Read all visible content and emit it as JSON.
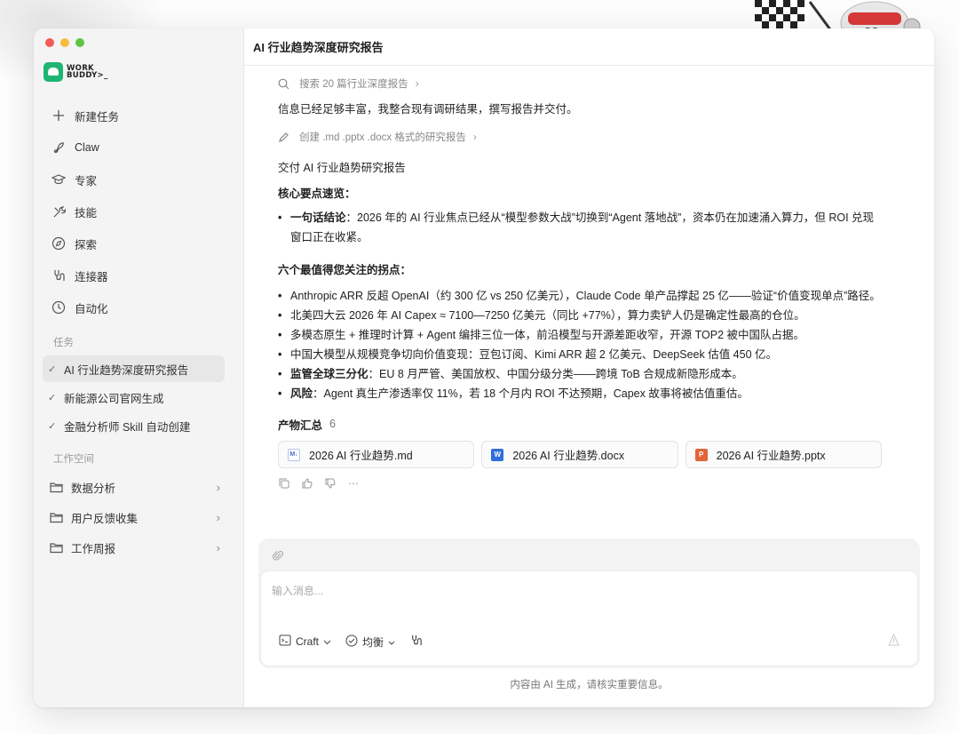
{
  "app": {
    "logo_text_line1": "WORK",
    "logo_text_line2": "BUDDY>_"
  },
  "sidebar": {
    "nav": [
      {
        "label": "新建任务",
        "icon": "plus-icon"
      },
      {
        "label": "Claw",
        "icon": "claw-icon"
      },
      {
        "label": "专家",
        "icon": "graduation-cap-icon"
      },
      {
        "label": "技能",
        "icon": "tools-icon"
      },
      {
        "label": "探索",
        "icon": "compass-icon"
      },
      {
        "label": "连接器",
        "icon": "connector-icon"
      },
      {
        "label": "自动化",
        "icon": "clock-icon"
      }
    ],
    "tasks_label": "任务",
    "tasks": [
      {
        "label": "AI 行业趋势深度研究报告",
        "active": true
      },
      {
        "label": "新能源公司官网生成",
        "active": false
      },
      {
        "label": "金融分析师 Skill 自动创建",
        "active": false
      }
    ],
    "workspace_label": "工作空间",
    "workspaces": [
      {
        "label": "数据分析"
      },
      {
        "label": "用户反馈收集"
      },
      {
        "label": "工作周报"
      }
    ]
  },
  "main": {
    "title": "AI 行业趋势深度研究报告",
    "step_search": "搜索 20 篇行业深度报告",
    "para_1": "信息已经足够丰富，我整合现有调研结果，撰写报告并交付。",
    "step_create": "创建 .md .pptx .docx 格式的研究报告",
    "para_2": "交付 AI 行业趋势研究报告",
    "heading_core": "核心要点速览：",
    "core_bullet_bold": "一句话结论",
    "core_bullet_text": "：2026 年的 AI 行业焦点已经从“模型参数大战”切换到“Agent 落地战”，资本仍在加速涌入算力，但 ROI 兑现窗口正在收紧。",
    "heading_turns": "六个最值得您关注的拐点：",
    "turns": [
      {
        "bold": "",
        "text": "Anthropic ARR 反超 OpenAI（约 300 亿 vs 250 亿美元），Claude Code 单产品撑起 25 亿——验证“价值变现单点”路径。"
      },
      {
        "bold": "",
        "text": "北美四大云 2026 年 AI Capex ≈ 7100—7250 亿美元（同比 +77%），算力卖铲人仍是确定性最高的仓位。"
      },
      {
        "bold": "",
        "text": "多模态原生 + 推理时计算 + Agent 编排三位一体，前沿模型与开源差距收窄，开源 TOP2 被中国队占据。"
      },
      {
        "bold": "",
        "text": "中国大模型从规模竞争切向价值变现：豆包订阅、Kimi ARR 超 2 亿美元、DeepSeek 估值 450 亿。"
      },
      {
        "bold": "监管全球三分化",
        "text": "：EU 8 月严管、美国放权、中国分级分类——跨境 ToB 合规成新隐形成本。"
      },
      {
        "bold": "风险",
        "text": "：Agent 真生产渗透率仅 11%，若 18 个月内 ROI 不达预期，Capex 故事将被估值重估。"
      }
    ],
    "files_heading": "产物汇总",
    "files_count": "6",
    "files": [
      {
        "name": "2026 AI 行业趋势.md",
        "type": "md",
        "badge": "M↓"
      },
      {
        "name": "2026 AI 行业趋势.docx",
        "type": "docx",
        "badge": "W"
      },
      {
        "name": "2026 AI 行业趋势.pptx",
        "type": "pptx",
        "badge": "P"
      }
    ]
  },
  "composer": {
    "placeholder": "输入消息...",
    "mode_label": "Craft",
    "balance_label": "均衡",
    "disclaimer": "内容由 AI 生成，请核实重要信息。"
  },
  "colors": {
    "brand_green": "#1fb574",
    "sidebar_bg": "#f4f4f4",
    "active_item_bg": "#e7e7e7",
    "docx_blue": "#2f6fd9",
    "pptx_orange": "#e1643a"
  }
}
